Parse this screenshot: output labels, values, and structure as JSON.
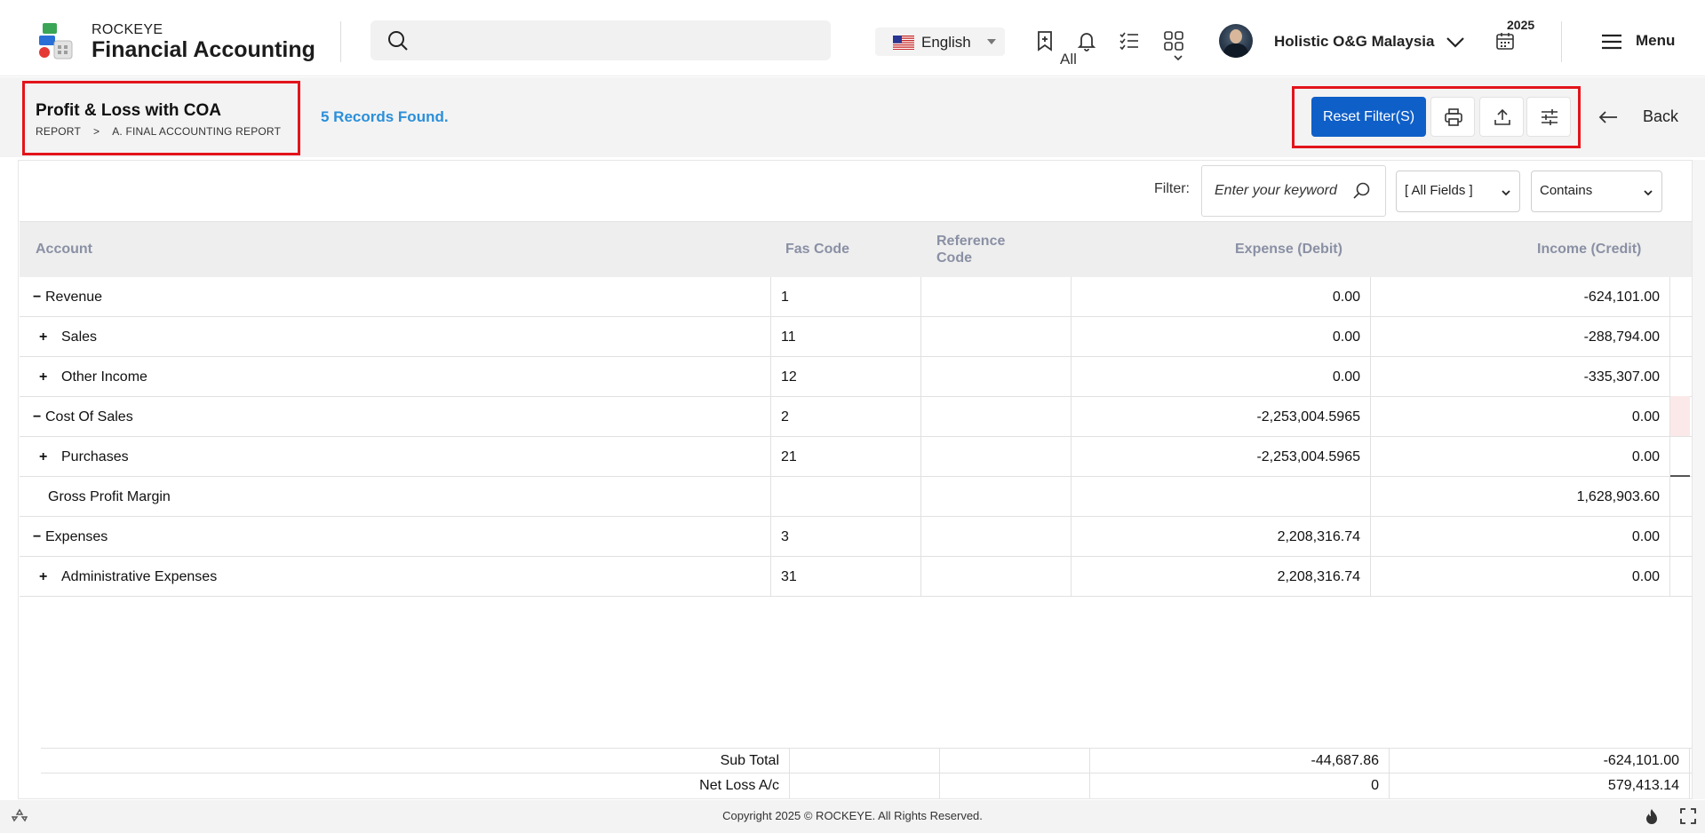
{
  "header": {
    "brand_top": "ROCKEYE",
    "brand_bottom": "Financial Accounting",
    "search": {
      "placeholder": "",
      "scope": "All"
    },
    "language": "English",
    "company": "Holistic O&G Malaysia",
    "year": "2025",
    "menu_label": "Menu",
    "icons": [
      "bookmark-add-icon",
      "bell-icon",
      "checklist-icon",
      "apps-grid-icon"
    ]
  },
  "subheader": {
    "title": "Profit & Loss with COA",
    "breadcrumb": [
      "REPORT",
      ">",
      "A. FINAL ACCOUNTING REPORT"
    ],
    "records_found": "5 Records Found.",
    "reset_label": "Reset Filter(S)",
    "back_label": "Back"
  },
  "filter": {
    "label": "Filter:",
    "keyword_placeholder": "Enter your keyword",
    "field_select": "[ All Fields ]",
    "operator_select": "Contains"
  },
  "table": {
    "columns": [
      "Account",
      "Fas Code",
      "Reference Code",
      "Expense (Debit)",
      "Income (Credit)"
    ],
    "rows": [
      {
        "toggle": "−",
        "indent": 0,
        "account": "Revenue",
        "fas": "1",
        "ref": "",
        "debit": "0.00",
        "credit": "-624,101.00"
      },
      {
        "toggle": "+",
        "indent": 1,
        "account": "Sales",
        "fas": "11",
        "ref": "",
        "debit": "0.00",
        "credit": "-288,794.00"
      },
      {
        "toggle": "+",
        "indent": 1,
        "account": "Other Income",
        "fas": "12",
        "ref": "",
        "debit": "0.00",
        "credit": "-335,307.00"
      },
      {
        "toggle": "−",
        "indent": 0,
        "account": "Cost Of Sales",
        "fas": "2",
        "ref": "",
        "debit": "-2,253,004.5965",
        "credit": "0.00"
      },
      {
        "toggle": "+",
        "indent": 1,
        "account": "Purchases",
        "fas": "21",
        "ref": "",
        "debit": "-2,253,004.5965",
        "credit": "0.00"
      },
      {
        "toggle": "",
        "indent": 0,
        "account": "Gross Profit Margin",
        "fas": "",
        "ref": "",
        "debit": "",
        "credit": "1,628,903.60"
      },
      {
        "toggle": "−",
        "indent": 0,
        "account": "Expenses",
        "fas": "3",
        "ref": "",
        "debit": "2,208,316.74",
        "credit": "0.00"
      },
      {
        "toggle": "+",
        "indent": 1,
        "account": "Administrative Expenses",
        "fas": "31",
        "ref": "",
        "debit": "2,208,316.74",
        "credit": "0.00"
      }
    ],
    "totals": [
      {
        "label": "Sub Total",
        "debit": "-44,687.86",
        "credit": "-624,101.00"
      },
      {
        "label": "Net Loss A/c",
        "debit": "0",
        "credit": "579,413.14"
      }
    ]
  },
  "footer": {
    "copyright": "Copyright 2025 © ROCKEYE. All Rights Reserved."
  },
  "colors": {
    "accent": "#0f5fc8",
    "highlight_border": "#e3141b",
    "records_text": "#2b8fd9"
  }
}
